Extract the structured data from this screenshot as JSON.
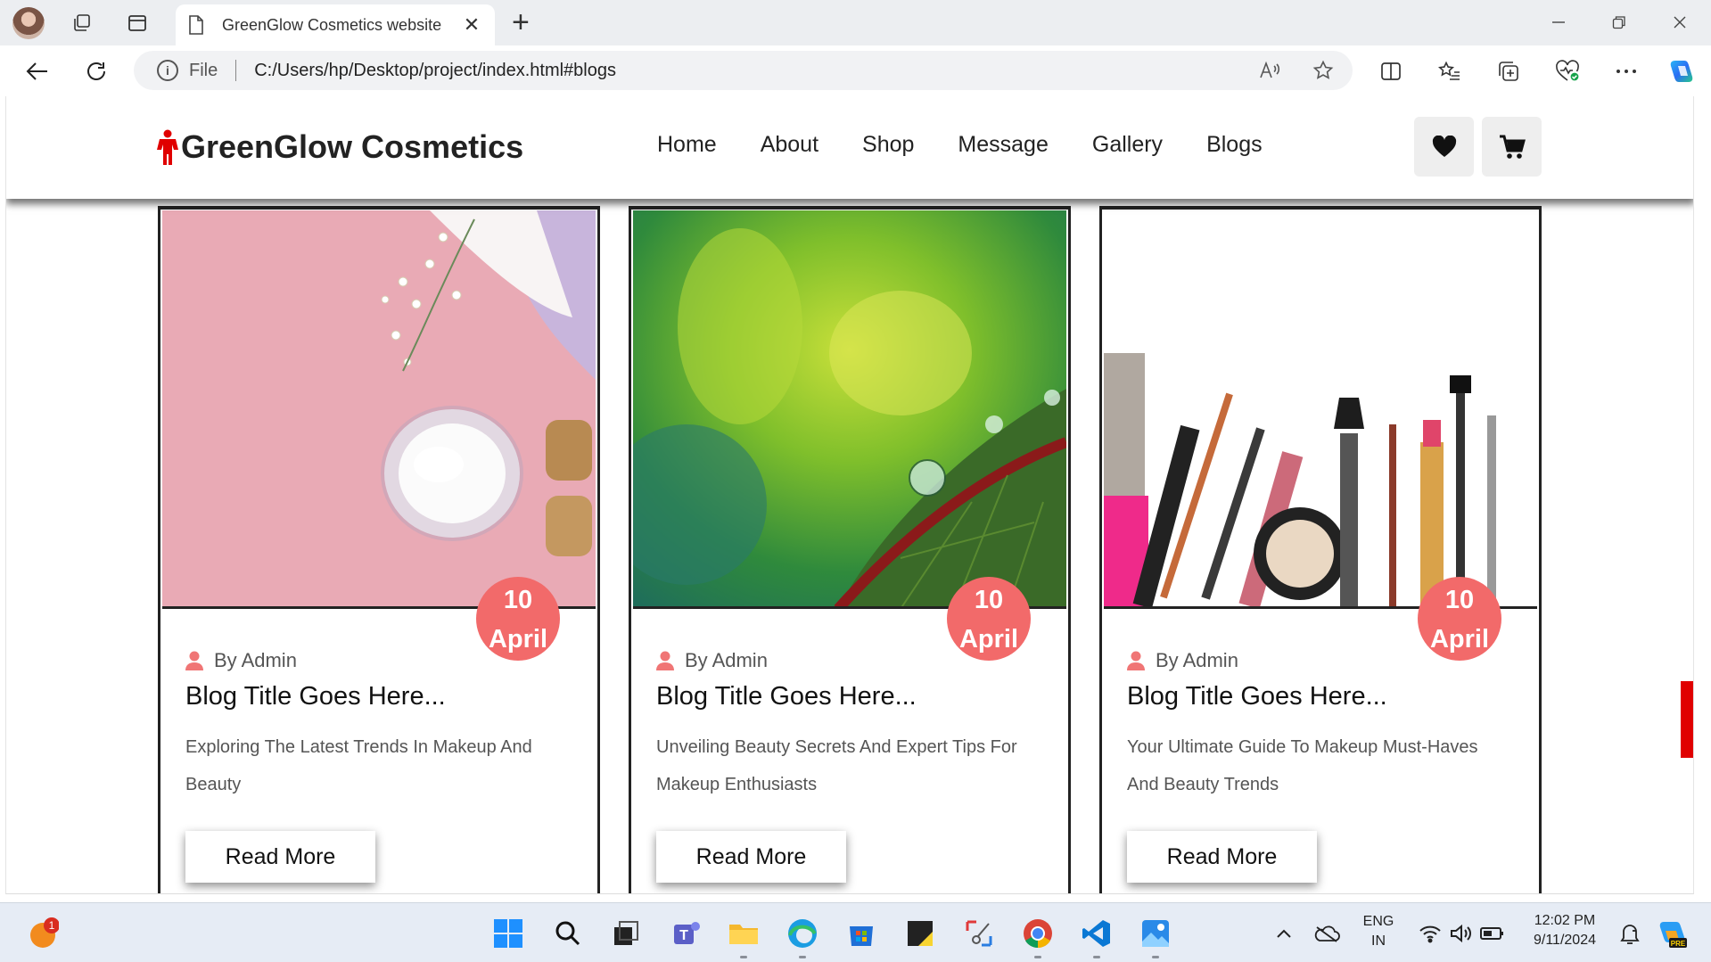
{
  "browser": {
    "tab_title": "GreenGlow Cosmetics website",
    "address_scheme": "File",
    "address_url": "C:/Users/hp/Desktop/project/index.html#blogs"
  },
  "site": {
    "brand": "GreenGlow Cosmetics",
    "nav": [
      "Home",
      "About",
      "Shop",
      "Message",
      "Gallery",
      "Blogs"
    ],
    "icons": {
      "wishlist": "heart-icon",
      "cart": "cart-icon"
    },
    "accent_color": "#f26a6a",
    "logo_color": "#e00000"
  },
  "blogs": [
    {
      "date_day": "10",
      "date_month": "April",
      "author": "By Admin",
      "title": "Blog Title Goes Here...",
      "desc": "Exploring The Latest Trends In Makeup And Beauty",
      "cta": "Read More",
      "image": "pink cream jar with flowers"
    },
    {
      "date_day": "10",
      "date_month": "April",
      "author": "By Admin",
      "title": "Blog Title Goes Here...",
      "desc": "Unveiling Beauty Secrets And Expert Tips For Makeup Enthusiasts",
      "cta": "Read More",
      "image": "green leaf with water droplets"
    },
    {
      "date_day": "10",
      "date_month": "April",
      "author": "By Admin",
      "title": "Blog Title Goes Here...",
      "desc": "Your Ultimate Guide To Makeup Must-Haves And Beauty Trends",
      "cta": "Read More",
      "image": "makeup products flat lay"
    }
  ],
  "taskbar": {
    "notification_count": "1",
    "lang_line1": "ENG",
    "lang_line2": "IN",
    "time": "12:02 PM",
    "date": "9/11/2024"
  }
}
